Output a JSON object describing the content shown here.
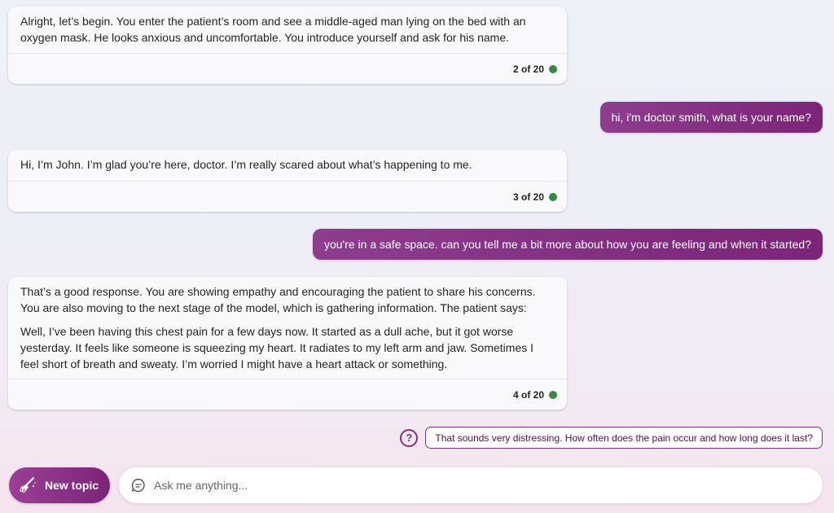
{
  "messages": [
    {
      "role": "bot",
      "paragraphs": [
        "Alright, let’s begin. You enter the patient’s room and see a middle-aged man lying on the bed with an oxygen mask. He looks anxious and uncomfortable. You introduce yourself and ask for his name."
      ],
      "counter": "2 of 20"
    },
    {
      "role": "user",
      "text": "hi, i'm doctor smith, what is your name?"
    },
    {
      "role": "bot",
      "paragraphs": [
        "Hi, I’m John. I’m glad you’re here, doctor. I’m really scared about what’s happening to me."
      ],
      "counter": "3 of 20"
    },
    {
      "role": "user",
      "text": "you're in a safe space. can you tell me a bit more about how you are feeling and when it started?"
    },
    {
      "role": "bot",
      "paragraphs": [
        "That’s a good response. You are showing empathy and encouraging the patient to share his concerns. You are also moving to the next stage of the model, which is gathering information. The patient says:",
        "Well, I’ve been having this chest pain for a few days now. It started as a dull ache, but it got worse yesterday. It feels like someone is squeezing my heart. It radiates to my left arm and jaw. Sometimes I feel short of breath and sweaty. I’m worried I might have a heart attack or something."
      ],
      "counter": "4 of 20"
    }
  ],
  "suggestion": {
    "icon": "question-circle-icon",
    "text": "That sounds very distressing. How often does the pain occur and how long does it last?"
  },
  "composer": {
    "new_topic_label": "New topic",
    "new_topic_icon": "broom-icon",
    "input_icon": "chat-bubble-icon",
    "placeholder": "Ask me anything...",
    "value": ""
  },
  "colors": {
    "accent": "#8a2e7f",
    "status_ok": "#2e8b3f"
  }
}
